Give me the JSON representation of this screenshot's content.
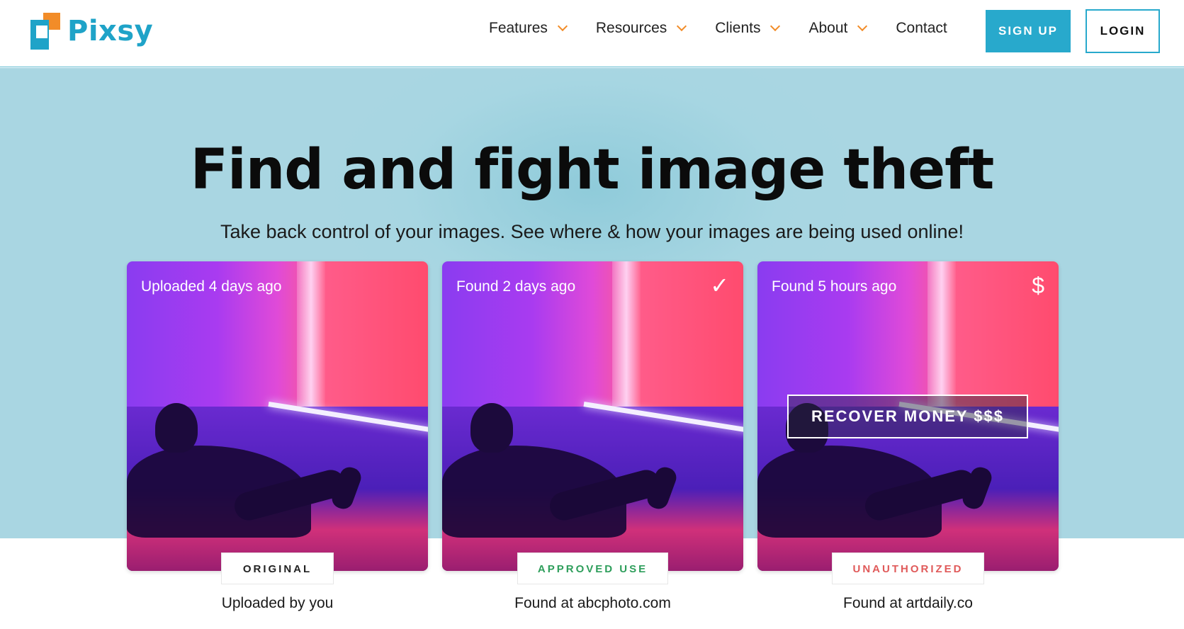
{
  "header": {
    "logo_text": "Pixsy",
    "nav": [
      {
        "label": "Features",
        "has_dropdown": true
      },
      {
        "label": "Resources",
        "has_dropdown": true
      },
      {
        "label": "Clients",
        "has_dropdown": true
      },
      {
        "label": "About",
        "has_dropdown": true
      },
      {
        "label": "Contact",
        "has_dropdown": false
      }
    ],
    "signup_label": "SIGN UP",
    "login_label": "LOGIN"
  },
  "hero": {
    "title": "Find and fight image theft",
    "subtitle": "Take back control of your images. See where & how your images are being used online!"
  },
  "cards": [
    {
      "caption": "Uploaded 4 days ago",
      "icon": "",
      "badge": "ORIGINAL",
      "badge_color": "#222222",
      "label": "Uploaded by you"
    },
    {
      "caption": "Found 2 days ago",
      "icon": "✓",
      "badge": "APPROVED USE",
      "badge_color": "#2e9e5b",
      "label": "Found at abcphoto.com"
    },
    {
      "caption": "Found 5 hours ago",
      "icon": "$",
      "badge": "UNAUTHORIZED",
      "badge_color": "#e05a5a",
      "label": "Found at artdaily.co",
      "action": "RECOVER MONEY $$$"
    }
  ],
  "colors": {
    "brand_blue": "#28a9cc",
    "brand_orange": "#f28c28",
    "hero_bg": "#a9d6e2"
  }
}
